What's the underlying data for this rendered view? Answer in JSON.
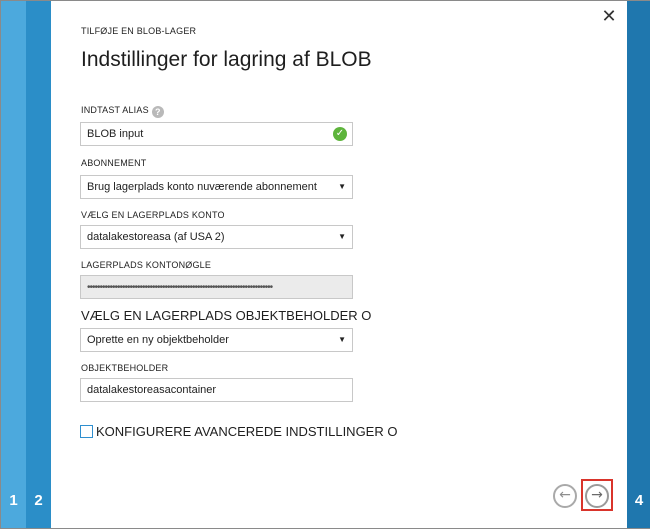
{
  "wizard": {
    "subtitle": "TILFØJE EN BLOB-LAGER",
    "title": "Indstillinger for lagring af BLOB",
    "close_icon": "close-icon",
    "steps": {
      "step1": "1",
      "step2": "2",
      "step4": "4"
    }
  },
  "form": {
    "alias": {
      "label": "INDTAST ALIAS",
      "help": "?",
      "value": "BLOB input",
      "status_icon": "check-circle-icon"
    },
    "subscription": {
      "label": "ABONNEMENT",
      "value": "Brug lagerplads konto nuværende abonnement",
      "arrow": "▼"
    },
    "storage_account": {
      "label": "VÆLG EN LAGERPLADS KONTO",
      "value": "datalakestoreasa (af USA 2)",
      "arrow": "▼"
    },
    "storage_key": {
      "label": "LAGERPLADS KONTONØGLE",
      "value": "••••••••••••••••••••••••••••••••••••••••••••••••••••••••••••••••••••••••••"
    },
    "container_select": {
      "label": "VÆLG EN LAGERPLADS OBJEKTBEHOLDER O",
      "value": "Oprette en ny objektbeholder",
      "arrow": "▼"
    },
    "container_name": {
      "label": "OBJEKTBEHOLDER",
      "value": "datalakestoreasacontainer"
    },
    "advanced": {
      "label": "KONFIGURERE AVANCEREDE INDSTILLINGER O",
      "checked": false
    }
  },
  "navigation": {
    "prev_icon": "arrow-left-icon",
    "next_icon": "arrow-right-icon",
    "prev_glyph": "←",
    "next_glyph": "→",
    "highlight_color": "#d9342b"
  }
}
